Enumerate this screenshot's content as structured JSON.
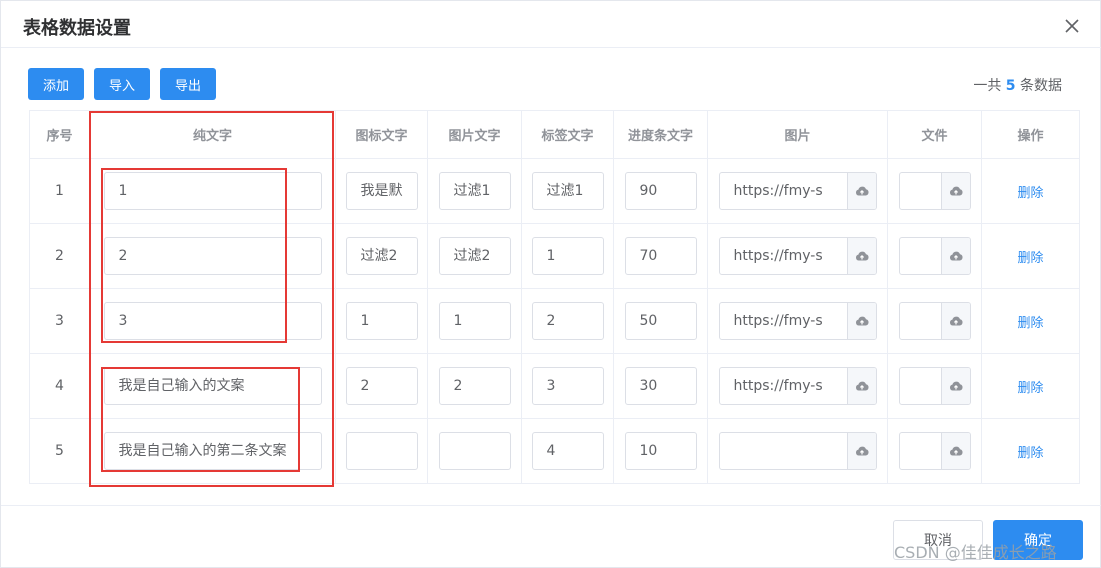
{
  "dialog": {
    "title": "表格数据设置"
  },
  "toolbar": {
    "add_label": "添加",
    "import_label": "导入",
    "export_label": "导出"
  },
  "summary": {
    "prefix": "一共",
    "count": "5",
    "suffix": "条数据"
  },
  "table": {
    "headers": [
      "序号",
      "纯文字",
      "图标文字",
      "图片文字",
      "标签文字",
      "进度条文字",
      "图片",
      "文件",
      "操作"
    ],
    "rows": [
      {
        "index": "1",
        "text": "1",
        "icon_text": "我是默",
        "image_text": "过滤1",
        "tag_text": "过滤1",
        "progress_text": "90",
        "image": "https://fmy-s",
        "file": "",
        "action": "删除"
      },
      {
        "index": "2",
        "text": "2",
        "icon_text": "过滤2",
        "image_text": "过滤2",
        "tag_text": "1",
        "progress_text": "70",
        "image": "https://fmy-s",
        "file": "",
        "action": "删除"
      },
      {
        "index": "3",
        "text": "3",
        "icon_text": "1",
        "image_text": "1",
        "tag_text": "2",
        "progress_text": "50",
        "image": "https://fmy-s",
        "file": "",
        "action": "删除"
      },
      {
        "index": "4",
        "text": "我是自己输入的文案",
        "icon_text": "2",
        "image_text": "2",
        "tag_text": "3",
        "progress_text": "30",
        "image": "https://fmy-s",
        "file": "",
        "action": "删除"
      },
      {
        "index": "5",
        "text": "我是自己输入的第二条文案",
        "icon_text": "",
        "image_text": "",
        "tag_text": "4",
        "progress_text": "10",
        "image": "",
        "file": "",
        "action": "删除"
      }
    ]
  },
  "footer": {
    "cancel_label": "取消",
    "confirm_label": "确定"
  },
  "watermark": "CSDN @佳佳成长之路",
  "icons": {
    "close": "close-icon",
    "upload": "cloud-upload-icon"
  },
  "colors": {
    "primary": "#2d8cf0",
    "highlight": "#e53935"
  }
}
